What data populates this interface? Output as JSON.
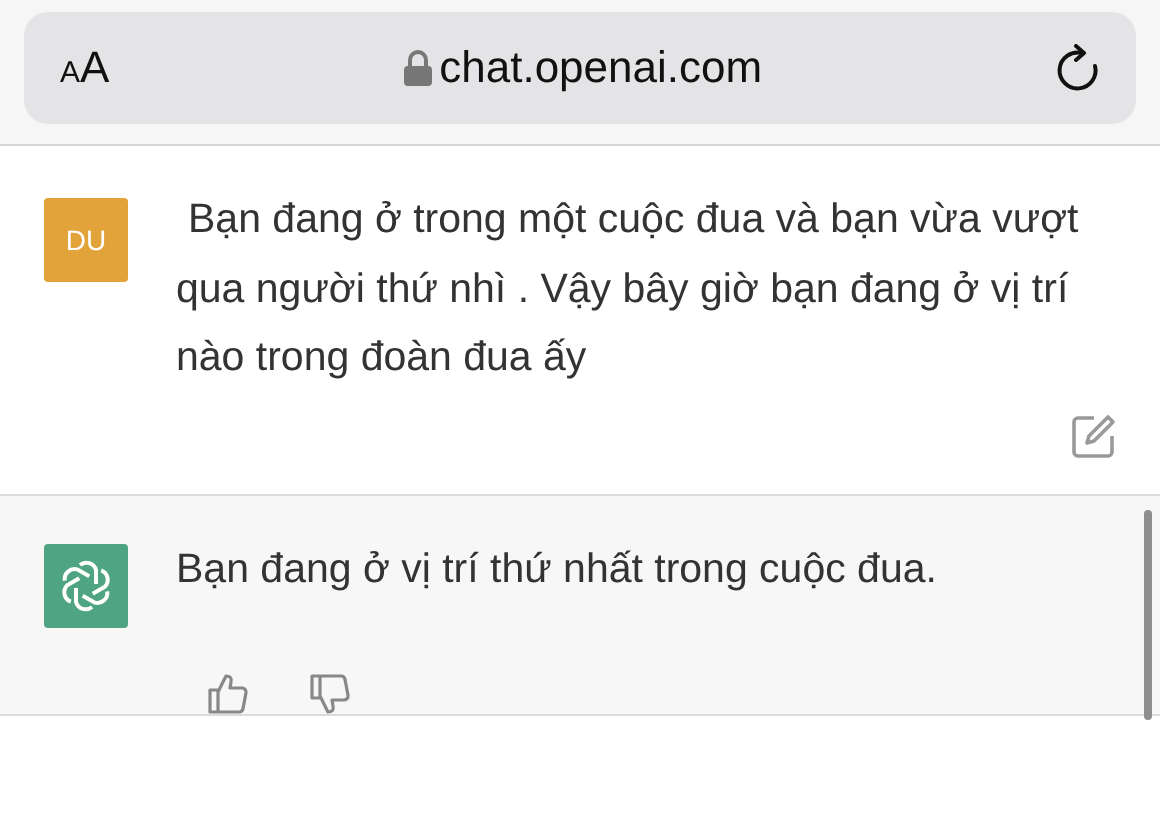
{
  "address_bar": {
    "text_size_button": "AA",
    "url": "chat.openai.com"
  },
  "messages": [
    {
      "kind": "user",
      "avatar": "DU",
      "text": "Bạn đang ở trong một cuộc đua và bạn vừa vượt qua người thứ nhì . Vậy bây giờ bạn đang ở vị trí nào trong đoàn đua ấy"
    },
    {
      "kind": "assistant",
      "text": "Bạn đang ở vị trí thứ nhất trong cuộc đua."
    }
  ]
}
